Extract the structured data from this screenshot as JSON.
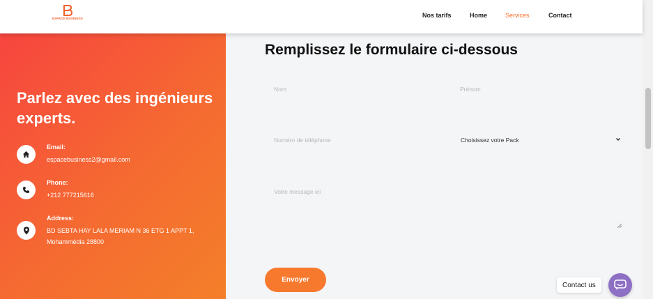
{
  "header": {
    "logo_text": "ESPACE BUSINESS",
    "nav": [
      {
        "label": "Nos tarifs"
      },
      {
        "label": "Home"
      },
      {
        "label": "Services",
        "active": true
      },
      {
        "label": "Contact"
      }
    ]
  },
  "left": {
    "heading": "Parlez avec des ingénieurs experts.",
    "contacts": [
      {
        "label": "Email:",
        "value": "espacebusiness2@gmail.com",
        "icon": "home-icon"
      },
      {
        "label": "Phone:",
        "value": "+212 777215616",
        "icon": "phone-icon"
      },
      {
        "label": "Address:",
        "value": "BD SEBTA HAY LALA MERIAM N 36 ETG 1 APPT 1, Mohammédia 28800",
        "icon": "location-pin-icon"
      }
    ]
  },
  "form": {
    "title": "Remplissez le formulaire ci-dessous",
    "nom_placeholder": "Nom",
    "prenom_placeholder": "Prénom",
    "phone_placeholder": "Numéro de téléphone",
    "pack_selected": "Choisissez votre Pack",
    "message_placeholder": "Votre message ici",
    "submit_label": "Envoyer"
  },
  "chat_widget": {
    "label": "Contact us"
  },
  "colors": {
    "accent": "#f7792e",
    "gradient_start": "#f7453f",
    "gradient_end": "#f47f2a",
    "chat": "#8d6fc4"
  }
}
